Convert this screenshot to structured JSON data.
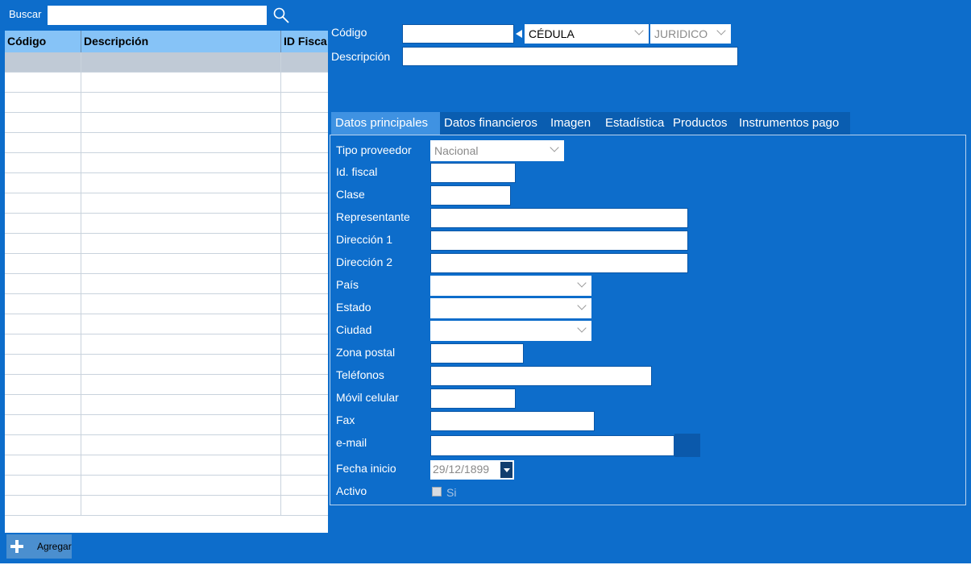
{
  "search": {
    "label": "Buscar",
    "value": ""
  },
  "grid": {
    "columns": [
      "Código",
      "Descripción",
      "ID Fisca"
    ],
    "row_count": 23
  },
  "add_button": {
    "label": "Agregar"
  },
  "header": {
    "codigo_label": "Código",
    "codigo_value": "",
    "doc_type": "CÉDULA",
    "person_type": "JURIDICO",
    "descripcion_label": "Descripción",
    "descripcion_value": ""
  },
  "tabs": [
    {
      "label": "Datos principales",
      "active": true
    },
    {
      "label": "Datos financieros",
      "active": false
    },
    {
      "label": "Imagen",
      "active": false
    },
    {
      "label": "Estadística",
      "active": false
    },
    {
      "label": "Productos",
      "active": false
    },
    {
      "label": "Instrumentos pago",
      "active": false
    }
  ],
  "form": {
    "tipo_proveedor_label": "Tipo proveedor",
    "tipo_proveedor_value": "Nacional",
    "id_fiscal_label": "Id. fiscal",
    "clase_label": "Clase",
    "representante_label": "Representante",
    "direccion1_label": "Dirección 1",
    "direccion2_label": "Dirección 2",
    "pais_label": "País",
    "estado_label": "Estado",
    "ciudad_label": "Ciudad",
    "zona_postal_label": "Zona postal",
    "telefonos_label": "Teléfonos",
    "movil_label": "Móvil celular",
    "fax_label": "Fax",
    "email_label": "e-mail",
    "fecha_inicio_label": "Fecha inicio",
    "fecha_inicio_value": "29/12/1899",
    "activo_label": "Activo",
    "activo_checkbox_label": "Si",
    "activo_checked": false
  },
  "colors": {
    "background": "#0d6dcb",
    "grid_header": "#86c3f7",
    "active_tab": "#3f92e2",
    "selected_row": "#c0cad6"
  }
}
